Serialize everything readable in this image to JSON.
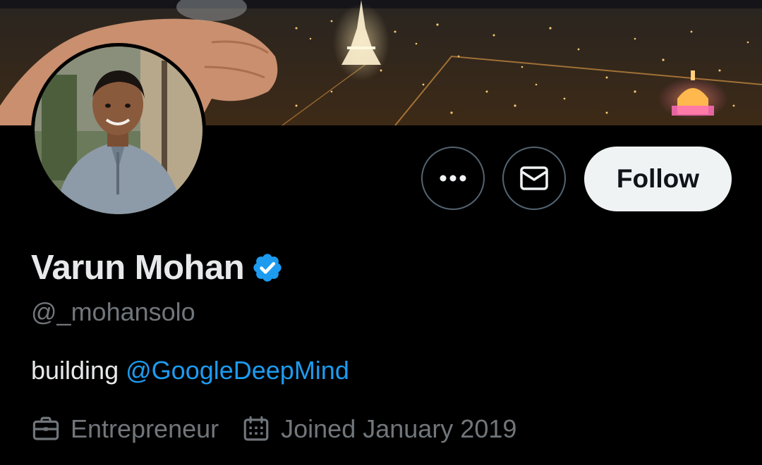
{
  "profile": {
    "display_name": "Varun Mohan",
    "handle": "@_mohansolo",
    "verified": true,
    "bio": {
      "text": "building",
      "mention": "@GoogleDeepMind"
    },
    "profession": "Entrepreneur",
    "joined": "Joined January 2019"
  },
  "actions": {
    "more_icon": "more-horizontal-icon",
    "message_icon": "envelope-icon",
    "follow_label": "Follow"
  },
  "icons": {
    "verified": "verified-badge-icon",
    "profession": "briefcase-icon",
    "joined": "calendar-icon"
  },
  "colors": {
    "background": "#000000",
    "primary_text": "#e7e9ea",
    "secondary_text": "#71767b",
    "link": "#1d9bf0",
    "verified_badge": "#1d9bf0",
    "follow_bg": "#eff3f4",
    "button_border": "#536471"
  }
}
